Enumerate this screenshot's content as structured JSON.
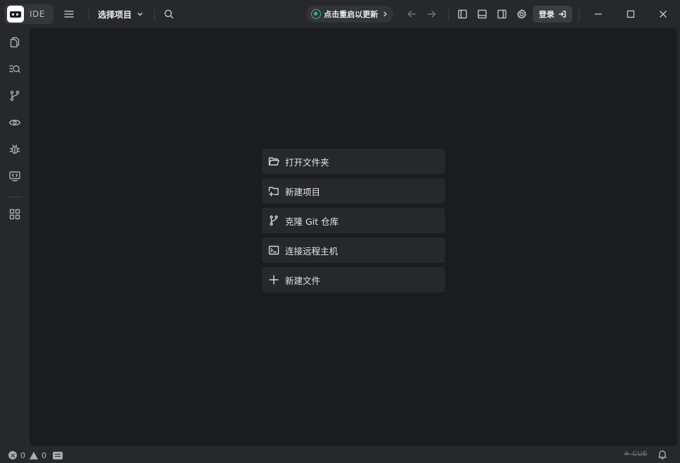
{
  "app": {
    "logo_text": "IDE"
  },
  "titlebar": {
    "project_select_label": "选择项目",
    "update_label": "点击重启以更新",
    "login_label": "登录"
  },
  "activity_bar": {
    "items": [
      {
        "id": "explorer",
        "icon": "files-icon"
      },
      {
        "id": "search",
        "icon": "search-list-icon"
      },
      {
        "id": "source-control",
        "icon": "git-branch-icon"
      },
      {
        "id": "preview",
        "icon": "eye-icon"
      },
      {
        "id": "debug",
        "icon": "bug-icon"
      },
      {
        "id": "remote",
        "icon": "remote-monitor-icon"
      },
      {
        "id": "extensions",
        "icon": "grid-icon"
      }
    ]
  },
  "welcome": {
    "items": [
      {
        "label": "打开文件夹",
        "icon": "folder-open-icon"
      },
      {
        "label": "新建项目",
        "icon": "new-project-icon"
      },
      {
        "label": "克隆 Git 仓库",
        "icon": "git-branch-icon"
      },
      {
        "label": "连接远程主机",
        "icon": "terminal-icon"
      },
      {
        "label": "新建文件",
        "icon": "plus-icon"
      }
    ]
  },
  "statusbar": {
    "errors": "0",
    "warnings": "0",
    "language_label": "CUE"
  },
  "colors": {
    "titlebar_bg": "#26282c",
    "editor_bg": "#1b1c1f",
    "accent_green": "#3fb27f"
  }
}
